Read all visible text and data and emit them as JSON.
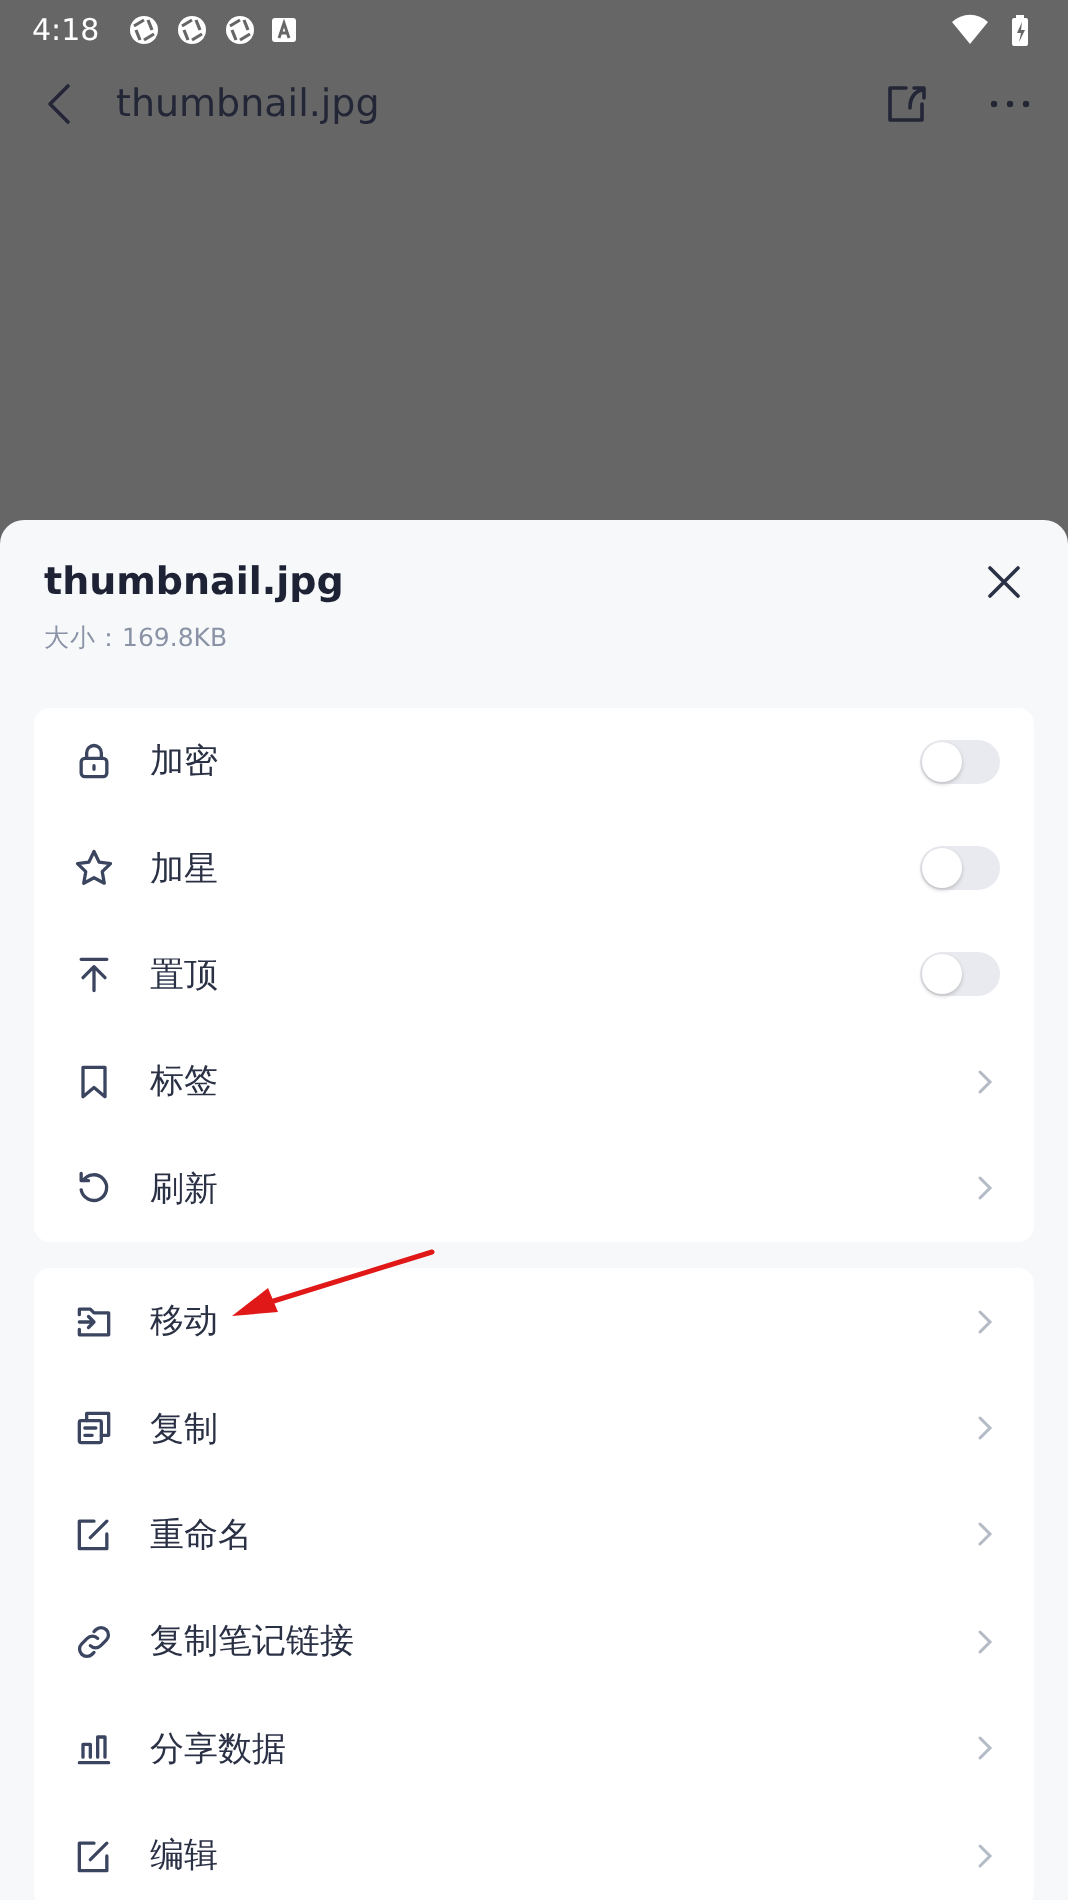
{
  "status_bar": {
    "time": "4:18"
  },
  "app_bar": {
    "title": "thumbnail.jpg"
  },
  "sheet": {
    "title": "thumbnail.jpg",
    "size": "大小：169.8KB",
    "groups": [
      {
        "items": [
          {
            "label": "加密",
            "kind": "toggle",
            "on": false
          },
          {
            "label": "加星",
            "kind": "toggle",
            "on": false
          },
          {
            "label": "置顶",
            "kind": "toggle",
            "on": false
          },
          {
            "label": "标签",
            "kind": "link"
          },
          {
            "label": "刷新",
            "kind": "link"
          }
        ]
      },
      {
        "items": [
          {
            "label": "移动",
            "kind": "link"
          },
          {
            "label": "复制",
            "kind": "link"
          },
          {
            "label": "重命名",
            "kind": "link"
          },
          {
            "label": "复制笔记链接",
            "kind": "link"
          },
          {
            "label": "分享数据",
            "kind": "link"
          },
          {
            "label": "编辑",
            "kind": "link"
          }
        ]
      }
    ]
  }
}
